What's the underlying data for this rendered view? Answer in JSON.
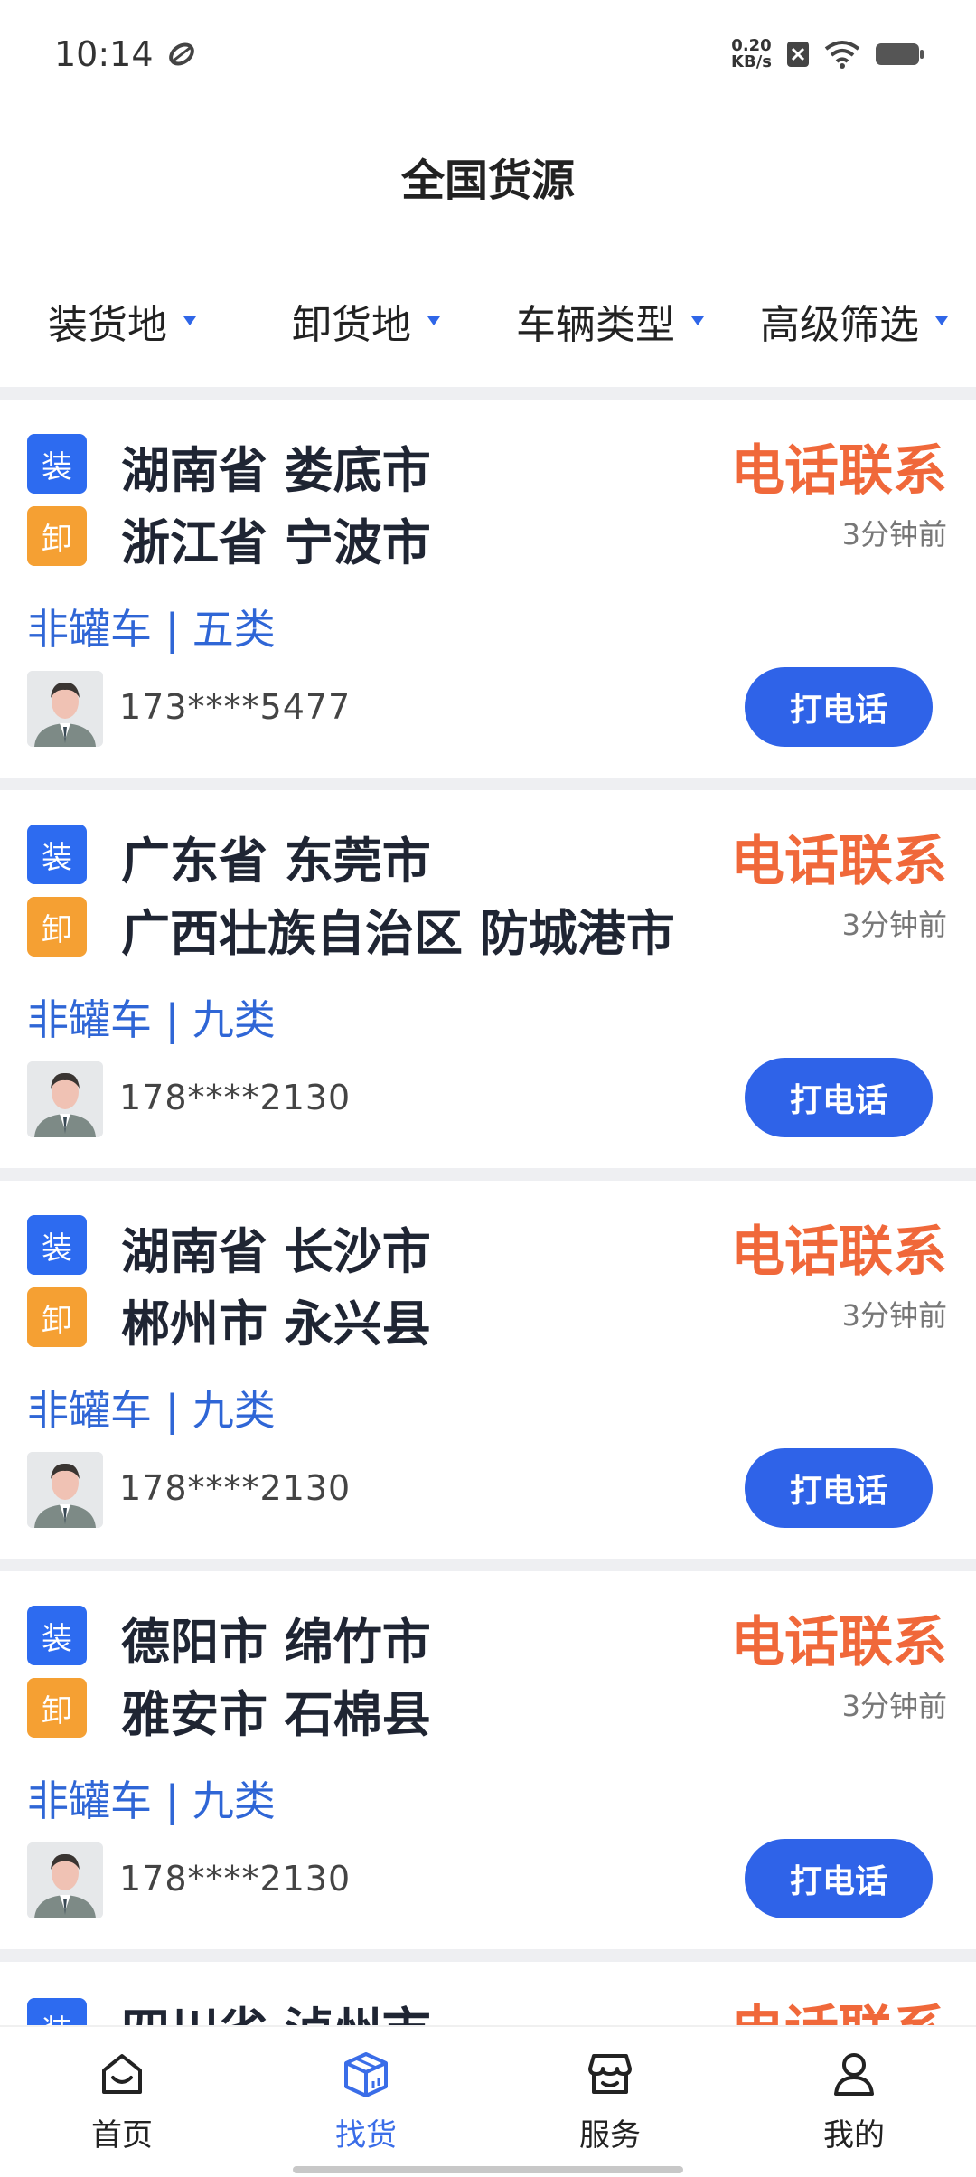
{
  "status_bar": {
    "time": "10:14",
    "net_speed_value": "0.20",
    "net_speed_unit": "KB/s"
  },
  "header": {
    "title": "全国货源"
  },
  "filters": [
    {
      "label": "装货地"
    },
    {
      "label": "卸货地"
    },
    {
      "label": "车辆类型"
    },
    {
      "label": "高级筛选"
    }
  ],
  "labels": {
    "load_tag": "装",
    "unload_tag": "卸",
    "contact": "电话联系",
    "call_button": "打电话"
  },
  "listings": [
    {
      "from": "湖南省 娄底市",
      "to": "浙江省 宁波市",
      "time_ago": "3分钟前",
      "truck": "非罐车 | 五类",
      "phone": "173****5477"
    },
    {
      "from": "广东省 东莞市",
      "to": "广西壮族自治区 防城港市",
      "time_ago": "3分钟前",
      "truck": "非罐车 | 九类",
      "phone": "178****2130"
    },
    {
      "from": "湖南省 长沙市",
      "to": "郴州市 永兴县",
      "time_ago": "3分钟前",
      "truck": "非罐车 | 九类",
      "phone": "178****2130"
    },
    {
      "from": "德阳市 绵竹市",
      "to": "雅安市 石棉县",
      "time_ago": "3分钟前",
      "truck": "非罐车 | 九类",
      "phone": "178****2130"
    },
    {
      "from": "四川省 泸州市"
    }
  ],
  "bottom_nav": [
    {
      "label": "首页",
      "icon": "home-icon"
    },
    {
      "label": "找货",
      "icon": "cargo-box-icon"
    },
    {
      "label": "服务",
      "icon": "store-icon"
    },
    {
      "label": "我的",
      "icon": "profile-icon"
    }
  ],
  "colors": {
    "accent_blue": "#2f63e8",
    "contact_orange": "#f0683a",
    "unload_tag": "#f5a033",
    "load_tag": "#2d6bf0"
  }
}
